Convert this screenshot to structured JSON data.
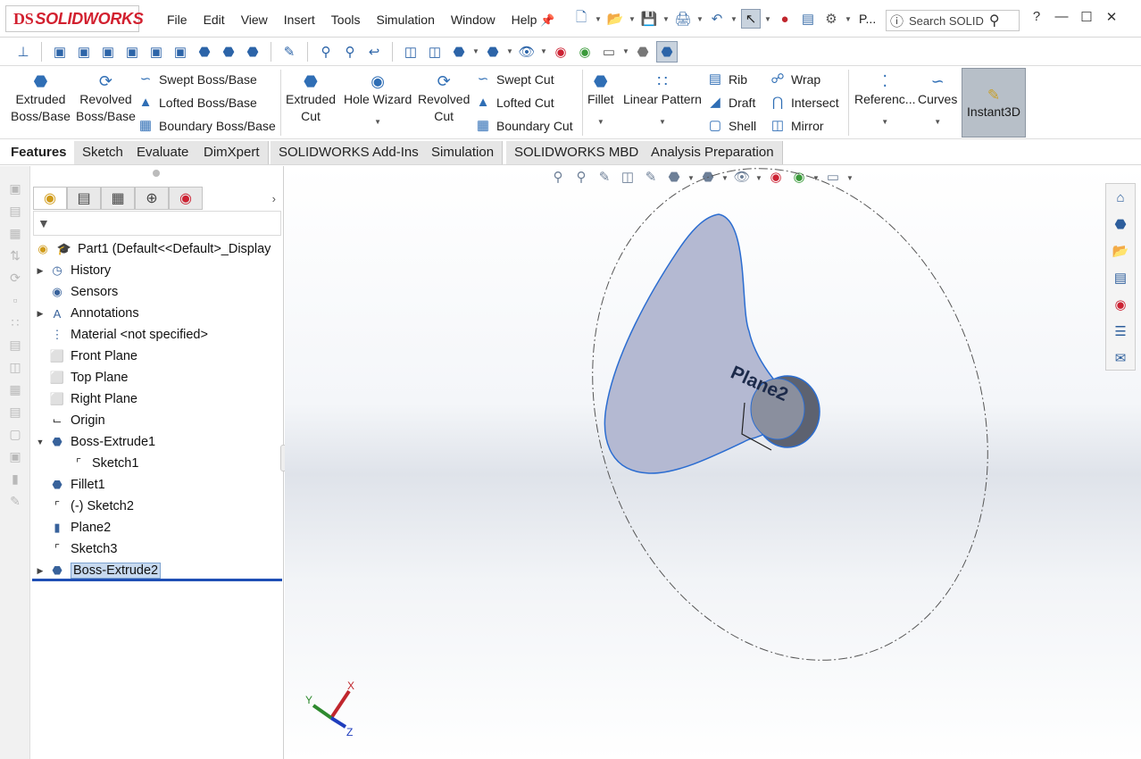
{
  "app": {
    "logo_text": "SOLIDWORKS",
    "logo_prefix": "DS"
  },
  "menu": [
    "File",
    "Edit",
    "View",
    "Insert",
    "Tools",
    "Simulation",
    "Window",
    "Help"
  ],
  "quick_access": {
    "truncated_label": "P...",
    "search_placeholder": "Search SOLID"
  },
  "commands": {
    "extruded_boss": "Extruded\nBoss/Base",
    "extruded_boss_l1": "Extruded",
    "extruded_boss_l2": "Boss/Base",
    "revolved_boss_l1": "Revolved",
    "revolved_boss_l2": "Boss/Base",
    "swept_boss": "Swept Boss/Base",
    "lofted_boss": "Lofted Boss/Base",
    "boundary_boss": "Boundary Boss/Base",
    "extruded_cut_l1": "Extruded",
    "extruded_cut_l2": "Cut",
    "hole_wizard": "Hole Wizard",
    "revolved_cut_l1": "Revolved",
    "revolved_cut_l2": "Cut",
    "swept_cut": "Swept Cut",
    "lofted_cut": "Lofted Cut",
    "boundary_cut": "Boundary Cut",
    "fillet": "Fillet",
    "linear_pattern": "Linear Pattern",
    "rib": "Rib",
    "draft": "Draft",
    "shell": "Shell",
    "wrap": "Wrap",
    "intersect": "Intersect",
    "mirror": "Mirror",
    "reference": "Referenc...",
    "curves": "Curves",
    "instant3d": "Instant3D"
  },
  "tabs": [
    "Features",
    "Sketch",
    "Evaluate",
    "DimXpert",
    "SOLIDWORKS Add-Ins",
    "Simulation",
    "SOLIDWORKS MBD",
    "Analysis Preparation"
  ],
  "tree": {
    "root": "Part1  (Default<<Default>_Display",
    "items": [
      "History",
      "Sensors",
      "Annotations",
      "Material <not specified>",
      "Front Plane",
      "Top Plane",
      "Right Plane",
      "Origin",
      "Boss-Extrude1",
      "Sketch1",
      "Fillet1",
      "(-) Sketch2",
      "Plane2",
      "Sketch3",
      "Boss-Extrude2"
    ]
  },
  "viewport": {
    "plane_label": "Plane2",
    "axis_x": "X",
    "axis_y": "Y",
    "axis_z": "Z"
  },
  "colors": {
    "accent": "#2f6eb5",
    "brand": "#d2202f",
    "selection": "#c7d9ef"
  }
}
